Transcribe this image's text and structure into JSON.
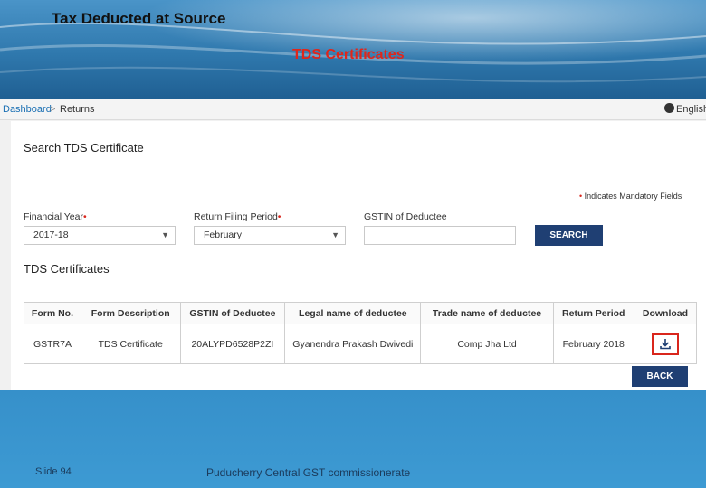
{
  "slide": {
    "title": "Tax Deducted at Source",
    "subtitle": "TDS Certificates",
    "footer_slide": "Slide 94",
    "footer_center": "Puducherry Central GST commissionerate"
  },
  "breadcrumb": {
    "dashboard": "Dashboard",
    "separator": ">",
    "returns": "Returns",
    "language": "English"
  },
  "search": {
    "title": "Search TDS Certificate",
    "mandatory_star": "•",
    "mandatory_text": "Indicates Mandatory Fields",
    "financial_year_label": "Financial Year",
    "financial_year_value": "2017-18",
    "return_period_label": "Return Filing Period",
    "return_period_value": "February",
    "gstin_label": "GSTIN of Deductee",
    "gstin_value": "",
    "search_button": "SEARCH"
  },
  "certificates": {
    "title": "TDS Certificates",
    "headers": [
      "Form No.",
      "Form Description",
      "GSTIN of Deductee",
      "Legal name of deductee",
      "Trade name of deductee",
      "Return Period",
      "Download"
    ],
    "rows": [
      [
        "GSTR7A",
        "TDS Certificate",
        "20ALYPD6528P2ZI",
        "Gyanendra Prakash Dwivedi",
        "Comp Jha Ltd",
        "February 2018"
      ]
    ],
    "back_button": "BACK"
  },
  "colors": {
    "accent": "#1f3f73",
    "link": "#1a6fb3",
    "required": "#d9261c",
    "subtitle": "#e0261b"
  },
  "icons": {
    "download": "download-icon",
    "globe": "globe-icon",
    "dropdown": "chevron-down-icon"
  }
}
